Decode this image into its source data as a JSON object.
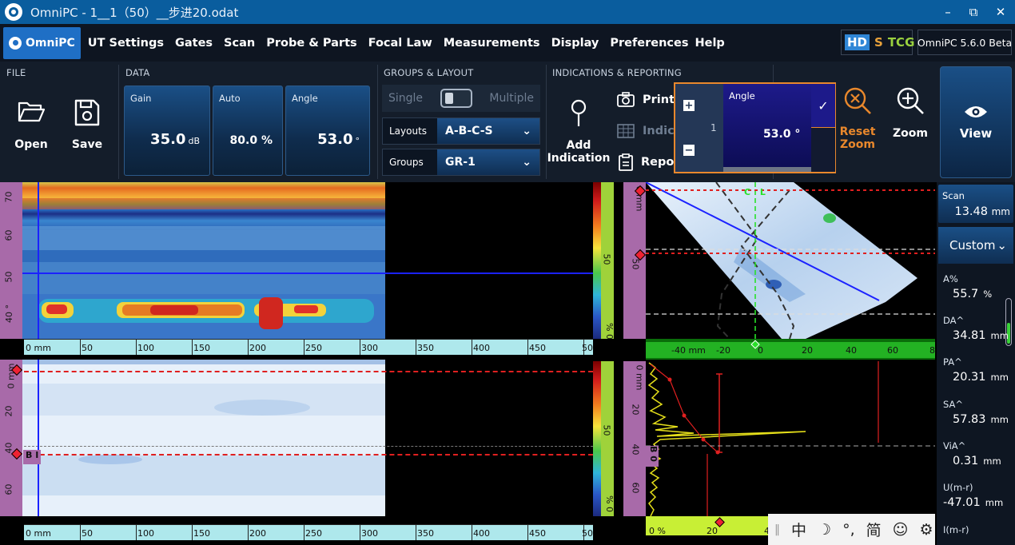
{
  "window": {
    "title": "OmniPC - 1__1（50）__步进20.odat",
    "controls": [
      "–",
      "⧉",
      "✕"
    ]
  },
  "menu": {
    "home": "OmniPC",
    "items": [
      "UT Settings",
      "Gates",
      "Scan",
      "Probe & Parts",
      "Focal Law",
      "Measurements",
      "Display",
      "Preferences",
      "Help"
    ],
    "mode_hd": "HD",
    "mode_s": "S",
    "mode_tcg": "TCG",
    "version": "OmniPC 5.6.0 Beta"
  },
  "ribbon": {
    "file": {
      "title": "FILE",
      "open": "Open",
      "save": "Save"
    },
    "data": {
      "title": "DATA",
      "gain": {
        "label": "Gain",
        "value": "35.0",
        "unit": "dB"
      },
      "auto": {
        "label": "Auto",
        "value": "80.0 %"
      },
      "angle": {
        "label": "Angle",
        "value": "53.0",
        "unit": "°"
      }
    },
    "groups_layout": {
      "title": "GROUPS & LAYOUT",
      "single": "Single",
      "multiple": "Multiple",
      "layouts_label": "Layouts",
      "layouts_value": "A-B-C-S",
      "groups_label": "Groups",
      "groups_value": "GR-1"
    },
    "indications": {
      "title": "INDICATIONS & REPORTING",
      "add_line1": "Add",
      "add_line2": "Indication",
      "print": "Print S",
      "indications": "Indica",
      "report": "Repor"
    },
    "angle_popup": {
      "label": "Angle",
      "value": "53.0 °",
      "step": "1"
    },
    "reset_line1": "Reset",
    "reset_line2": "Zoom",
    "zoom": "Zoom",
    "view": "View"
  },
  "cscan": {
    "v_ticks": [
      "70",
      "60",
      "50",
      "40 °"
    ],
    "h_ticks": [
      "0 mm",
      "50",
      "100",
      "150",
      "200",
      "250",
      "300",
      "350",
      "400",
      "450",
      "50"
    ]
  },
  "bscan": {
    "v_ticks": [
      "0 mm",
      "20",
      "40",
      "60"
    ],
    "h_ticks": [
      "0 mm",
      "50",
      "100",
      "150",
      "200",
      "250",
      "300",
      "350",
      "400",
      "450",
      "50"
    ],
    "gate_label": "B I"
  },
  "colorbar_top": {
    "labels": [
      "0 mm",
      "50",
      "% 0"
    ]
  },
  "colorbar_bottom": {
    "labels": [
      "0 mm",
      "20",
      "40",
      "60",
      "50",
      "% 0"
    ],
    "gate_label": "B 0"
  },
  "sscan": {
    "cl_label": "C L",
    "h_ticks": [
      "-40 mm",
      "-20",
      "0",
      "20",
      "40",
      "60",
      "8"
    ]
  },
  "ascan": {
    "h_ticks": [
      "0 %",
      "20",
      "4"
    ]
  },
  "side": {
    "scan_label": "Scan",
    "scan_value": "13.48",
    "scan_unit": "mm",
    "custom": "Custom",
    "measurements": [
      {
        "label": "A%",
        "value": "55.7",
        "unit": "%"
      },
      {
        "label": "DA^",
        "value": "34.81",
        "unit": "mm"
      },
      {
        "label": "PA^",
        "value": "20.31",
        "unit": "mm"
      },
      {
        "label": "SA^",
        "value": "57.83",
        "unit": "mm"
      },
      {
        "label": "ViA^",
        "value": "0.31",
        "unit": "mm"
      },
      {
        "label": "U(m-r)",
        "value": "-47.01",
        "unit": "mm"
      },
      {
        "label": "I(m-r)",
        "value": "",
        "unit": ""
      }
    ]
  },
  "ime": {
    "items": [
      "中",
      "☽",
      "°,",
      "简",
      "☺",
      "⚙"
    ]
  }
}
